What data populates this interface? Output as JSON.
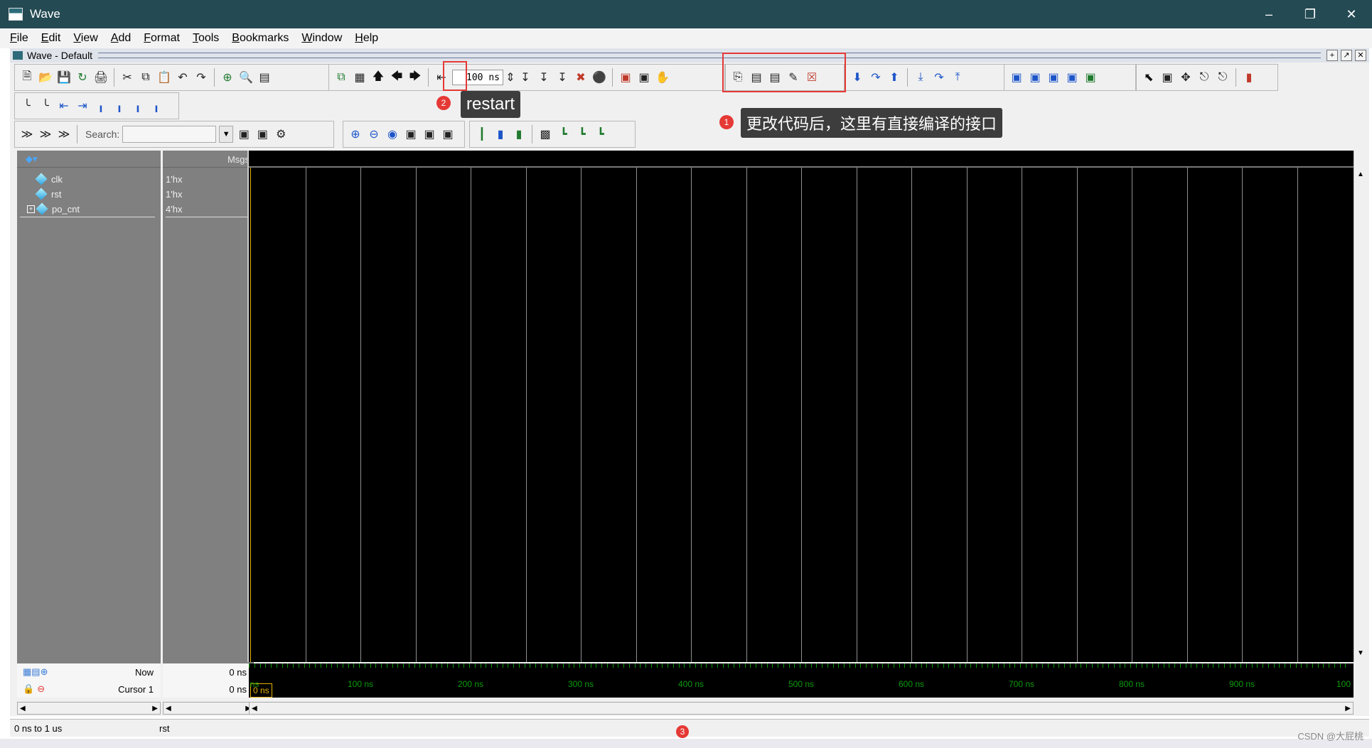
{
  "window": {
    "title": "Wave",
    "controls": [
      "–",
      "❐",
      "✕"
    ]
  },
  "menu": [
    "File",
    "Edit",
    "View",
    "Add",
    "Format",
    "Tools",
    "Bookmarks",
    "Window",
    "Help"
  ],
  "subwindow": {
    "title": "Wave - Default"
  },
  "toolbar": {
    "run_length": "100 ns",
    "search_label": "Search:"
  },
  "annotations": {
    "compile_tip": {
      "badge": "1",
      "text": "更改代码后，这里有直接编译的接口"
    },
    "restart_tip": {
      "badge": "2",
      "text": "restart"
    },
    "status_badge": "3",
    "accent": "#e53935"
  },
  "panes": {
    "msgs_header": "Msgs"
  },
  "signals": [
    {
      "name": "clk",
      "value": "1'hx"
    },
    {
      "name": "rst",
      "value": "1'hx"
    },
    {
      "name": "po_cnt",
      "value": "4'hx"
    }
  ],
  "cursors": {
    "now_label": "Now",
    "now_value": "0 ns",
    "cursor_label": "Cursor 1",
    "cursor_value": "0 ns",
    "cursor_flag": "0 ns"
  },
  "ruler_labels": [
    "ns",
    "100 ns",
    "200 ns",
    "300 ns",
    "400 ns",
    "500 ns",
    "600 ns",
    "700 ns",
    "800 ns",
    "900 ns",
    "100"
  ],
  "status": {
    "range": "0 ns to 1 us",
    "selected": "rst"
  },
  "watermark": "CSDN @大屁桃",
  "colors": {
    "title_bar": "#244a53",
    "wave_bg": "#000000",
    "ruler_text": "#0c9b0c",
    "cursor": "#e8b000"
  }
}
